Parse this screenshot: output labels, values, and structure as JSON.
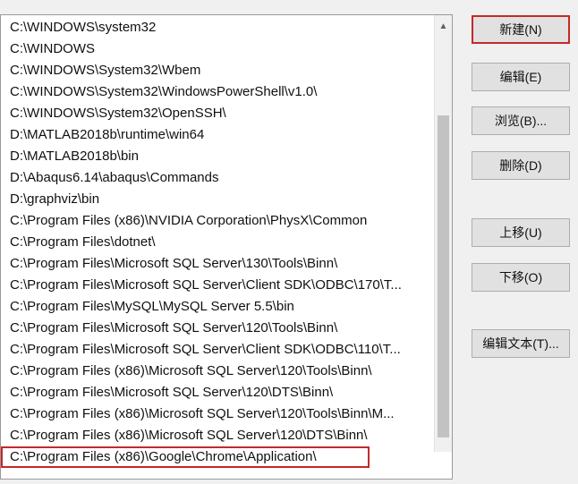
{
  "path_list": {
    "items": [
      "C:\\WINDOWS\\system32",
      "C:\\WINDOWS",
      "C:\\WINDOWS\\System32\\Wbem",
      "C:\\WINDOWS\\System32\\WindowsPowerShell\\v1.0\\",
      "C:\\WINDOWS\\System32\\OpenSSH\\",
      "D:\\MATLAB2018b\\runtime\\win64",
      "D:\\MATLAB2018b\\bin",
      "D:\\Abaqus6.14\\abaqus\\Commands",
      "D:\\graphviz\\bin",
      "C:\\Program Files (x86)\\NVIDIA Corporation\\PhysX\\Common",
      "C:\\Program Files\\dotnet\\",
      "C:\\Program Files\\Microsoft SQL Server\\130\\Tools\\Binn\\",
      "C:\\Program Files\\Microsoft SQL Server\\Client SDK\\ODBC\\170\\T...",
      "C:\\Program Files\\MySQL\\MySQL Server 5.5\\bin",
      "C:\\Program Files\\Microsoft SQL Server\\120\\Tools\\Binn\\",
      "C:\\Program Files\\Microsoft SQL Server\\Client SDK\\ODBC\\110\\T...",
      "C:\\Program Files (x86)\\Microsoft SQL Server\\120\\Tools\\Binn\\",
      "C:\\Program Files\\Microsoft SQL Server\\120\\DTS\\Binn\\",
      "C:\\Program Files (x86)\\Microsoft SQL Server\\120\\Tools\\Binn\\M...",
      "C:\\Program Files (x86)\\Microsoft SQL Server\\120\\DTS\\Binn\\",
      "C:\\Program Files (x86)\\Google\\Chrome\\Application\\"
    ],
    "highlighted_index": 20
  },
  "scrollbar": {
    "up_icon": "chevron-up-icon",
    "down_icon": "chevron-down-icon"
  },
  "buttons": {
    "new": "新建(N)",
    "edit": "编辑(E)",
    "browse": "浏览(B)...",
    "delete": "删除(D)",
    "move_up": "上移(U)",
    "move_down": "下移(O)",
    "edit_text": "编辑文本(T)..."
  },
  "colors": {
    "highlight_border": "#c62828"
  }
}
